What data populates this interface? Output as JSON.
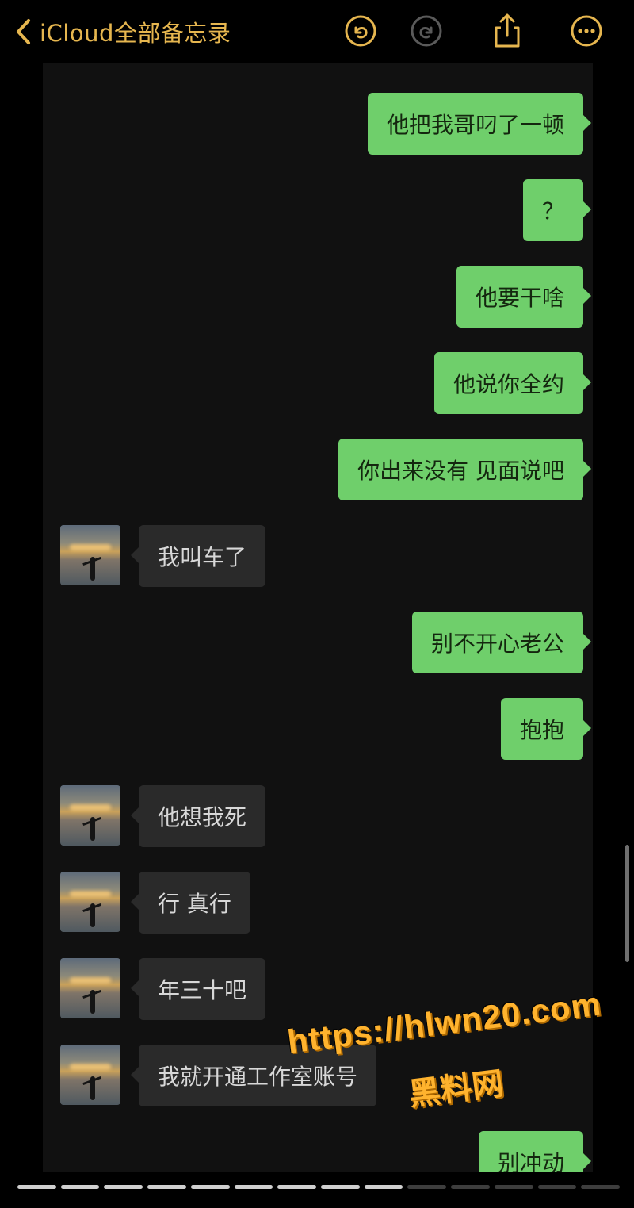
{
  "nav": {
    "back_label": "iCloud全部备忘录",
    "accent_color": "#e6b64f",
    "icons": [
      "chevron-left-icon",
      "undo-icon",
      "redo-icon",
      "share-icon",
      "more-icon"
    ]
  },
  "chat": {
    "outgoing_color": "#6fcf6b",
    "incoming_color": "#2a2a2a",
    "messages": [
      {
        "side": "out",
        "text": "他把我哥叼了一顿"
      },
      {
        "side": "out",
        "text": "？"
      },
      {
        "side": "out",
        "text": "他要干啥"
      },
      {
        "side": "out",
        "text": "他说你全约"
      },
      {
        "side": "out",
        "text": "你出来没有 见面说吧"
      },
      {
        "side": "in",
        "text": "我叫车了"
      },
      {
        "side": "out",
        "text": "别不开心老公"
      },
      {
        "side": "out",
        "text": "抱抱"
      },
      {
        "side": "in",
        "text": "他想我死"
      },
      {
        "side": "in",
        "text": "行 真行"
      },
      {
        "side": "in",
        "text": "年三十吧"
      },
      {
        "side": "in",
        "text": "我就开通工作室账号"
      },
      {
        "side": "out",
        "text": "别冲动"
      }
    ]
  },
  "watermark": {
    "url": "https://hlwn20.com",
    "name": "黑料网",
    "color": "#ffb32e"
  },
  "pager": {
    "total": 14,
    "active": 9
  }
}
